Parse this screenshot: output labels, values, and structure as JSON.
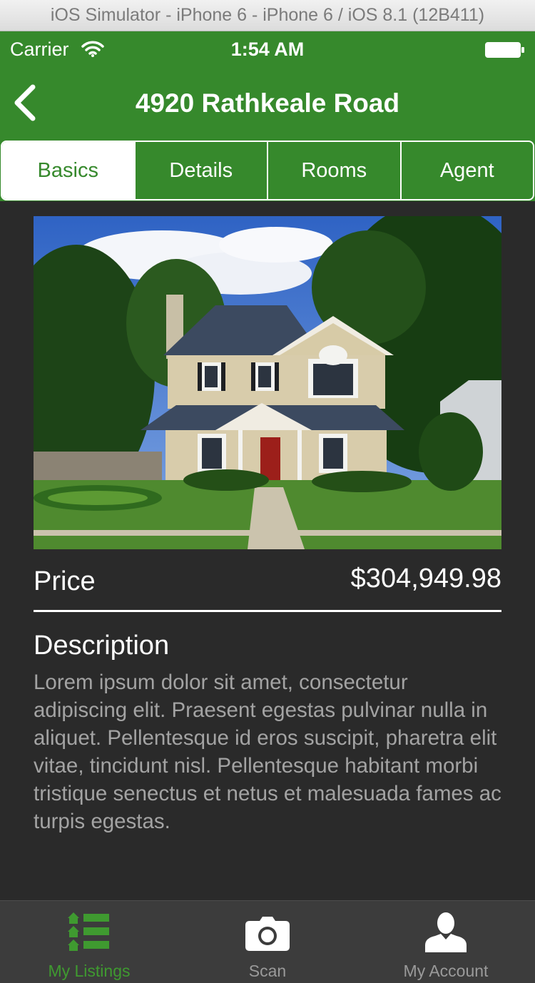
{
  "simulator": {
    "title": "iOS Simulator - iPhone 6 - iPhone 6 / iOS 8.1 (12B411)"
  },
  "status_bar": {
    "carrier": "Carrier",
    "time": "1:54 AM",
    "icons": [
      "wifi-icon",
      "battery-icon"
    ]
  },
  "nav": {
    "title": "4920 Rathkeale Road",
    "back_icon": "chevron-left-icon"
  },
  "tabs": [
    {
      "label": "Basics",
      "active": true
    },
    {
      "label": "Details",
      "active": false
    },
    {
      "label": "Rooms",
      "active": false
    },
    {
      "label": "Agent",
      "active": false
    }
  ],
  "listing": {
    "price_label": "Price",
    "price_value": "$304,949.98",
    "description_heading": "Description",
    "description": "Lorem ipsum dolor sit amet, consectetur adipiscing elit. Praesent egestas pulvinar nulla in aliquet. Pellentesque id eros suscipit, pharetra elit vitae, tincidunt nisl. Pellentesque habitant morbi tristique senectus et netus et malesuada fames ac turpis egestas."
  },
  "tab_bar": [
    {
      "label": "My Listings",
      "icon": "listings-icon",
      "active": true
    },
    {
      "label": "Scan",
      "icon": "camera-icon",
      "active": false
    },
    {
      "label": "My Account",
      "icon": "person-icon",
      "active": false
    }
  ],
  "colors": {
    "brand_green": "#36892c",
    "tab_active_green": "#3f9a30",
    "background": "#2a2a2a",
    "tab_bar": "#3c3c3c",
    "description_text": "#a3a3a3"
  }
}
